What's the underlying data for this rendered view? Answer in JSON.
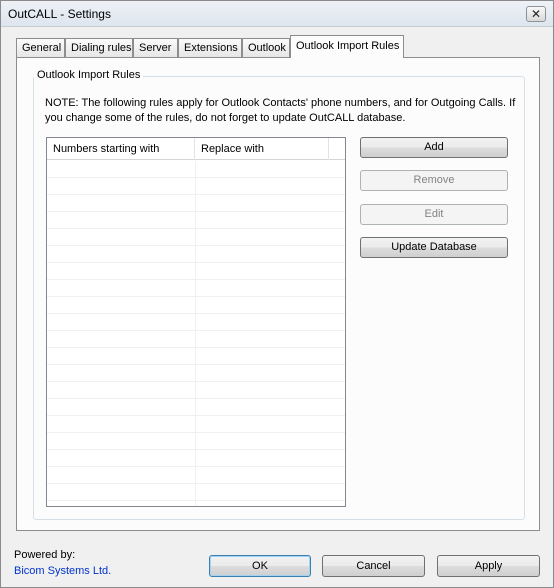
{
  "window": {
    "title": "OutCALL - Settings",
    "close_symbol": "✕"
  },
  "tabs": [
    {
      "label": "General"
    },
    {
      "label": "Dialing rules"
    },
    {
      "label": "Server"
    },
    {
      "label": "Extensions"
    },
    {
      "label": "Outlook"
    },
    {
      "label": "Outlook Import Rules",
      "active": true
    }
  ],
  "panel": {
    "group_title": "Outlook Import Rules",
    "note": "NOTE: The following rules apply for Outlook Contacts' phone numbers, and for Outgoing Calls. If you change some of the rules, do not forget to update OutCALL database.",
    "columns": [
      "Numbers starting with",
      "Replace with"
    ],
    "rows": [],
    "buttons": {
      "add": "Add",
      "remove": "Remove",
      "edit": "Edit",
      "update": "Update Database"
    }
  },
  "footer": {
    "powered_by": "Powered by:",
    "company": "Bicom Systems Ltd.",
    "ok": "OK",
    "cancel": "Cancel",
    "apply": "Apply"
  },
  "colors": {
    "link": "#0033cc",
    "default_button_border": "#3c7fb1"
  }
}
